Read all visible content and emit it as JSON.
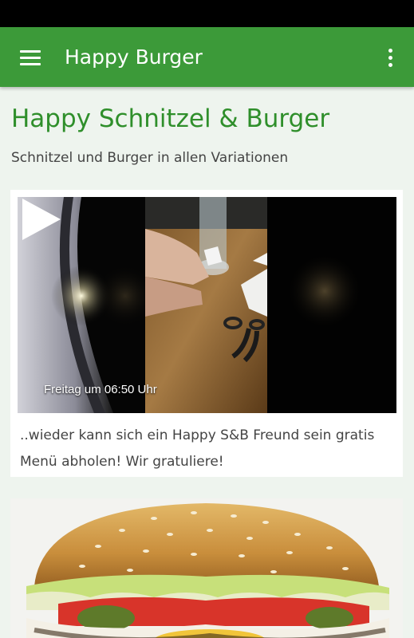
{
  "app_bar": {
    "title": "Happy Burger",
    "menu_icon": "hamburger-menu-icon",
    "overflow_icon": "more-vert-icon"
  },
  "header": {
    "title": "Happy Schnitzel & Burger",
    "subtitle": "Schnitzel und Burger in allen Variationen"
  },
  "posts": [
    {
      "type": "video",
      "video_caption": "Freitag um 06:50 Uhr",
      "text": "..wieder kann sich ein Happy S&B Freund sein gratis Menü abholen! Wir gratuliere!",
      "play_icon": "play-icon"
    },
    {
      "type": "image",
      "image": "burger-photo"
    }
  ],
  "colors": {
    "primary": "#3c9a39",
    "title_green": "#2f8f2b",
    "background": "#eef4ee"
  }
}
